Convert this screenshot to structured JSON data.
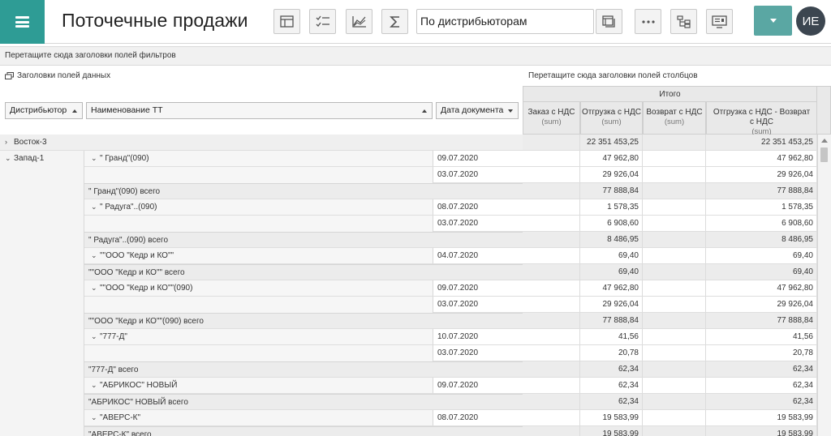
{
  "app": {
    "title": "Поточечные продажи",
    "view_select": "По дистрибьюторам",
    "avatar_initials": "ИЕ",
    "accent_color": "#2e9c95"
  },
  "toolbar": {
    "icons": [
      "table-layout-icon",
      "checklist-icon",
      "chart-icon",
      "sigma-icon",
      "view-list-icon",
      "more-icon",
      "hierarchy-icon",
      "screen-icon"
    ]
  },
  "pivot": {
    "filter_drop_hint": "Перетащите сюда заголовки полей фильтров",
    "data_headers_label": "Заголовки полей данных",
    "column_drop_hint": "Перетащите сюда заголовки полей столбцов",
    "row_fields": [
      "Дистрибьютор",
      "Наименование ТТ",
      "Дата документа"
    ],
    "total_header": "Итого",
    "columns": [
      {
        "label": "Заказ с НДС",
        "sub": "(sum)"
      },
      {
        "label": "Отгрузка с НДС",
        "sub": "(sum)"
      },
      {
        "label": "Возврат с НДС",
        "sub": "(sum)"
      },
      {
        "label": "Отгрузка с НДС - Возврат с НДС",
        "sub": "(sum)"
      }
    ]
  },
  "rows": [
    {
      "level": 0,
      "dist": "Восток-3",
      "dist_chev": ">",
      "shipment": "22 351 453,25",
      "net": "22 351 453,25"
    },
    {
      "level": 1,
      "dist": "Запад-1",
      "dist_chev": "v",
      "tt": "\" Гранд\"(090)",
      "tt_chev": "v",
      "date": "09.07.2020",
      "shipment": "47 962,80",
      "net": "47 962,80"
    },
    {
      "level": 2,
      "date": "03.07.2020",
      "shipment": "29 926,04",
      "net": "29 926,04"
    },
    {
      "level": 3,
      "tt_total": "\" Гранд\"(090) всего",
      "shipment": "77 888,84",
      "net": "77 888,84"
    },
    {
      "level": 1,
      "tt": "\" Радуга\"..(090)",
      "tt_chev": "v",
      "date": "08.07.2020",
      "shipment": "1 578,35",
      "net": "1 578,35"
    },
    {
      "level": 2,
      "date": "03.07.2020",
      "shipment": "6 908,60",
      "net": "6 908,60"
    },
    {
      "level": 3,
      "tt_total": "\" Радуга\"..(090) всего",
      "shipment": "8 486,95",
      "net": "8 486,95"
    },
    {
      "level": 1,
      "tt": "\"\"ООО \"Кедр и КО\"\"",
      "tt_chev": "v",
      "date": "04.07.2020",
      "shipment": "69,40",
      "net": "69,40"
    },
    {
      "level": 3,
      "tt_total": "\"\"ООО \"Кедр и КО\"\" всего",
      "shipment": "69,40",
      "net": "69,40"
    },
    {
      "level": 1,
      "tt": "\"\"ООО \"Кедр и КО\"\"(090)",
      "tt_chev": "v",
      "date": "09.07.2020",
      "shipment": "47 962,80",
      "net": "47 962,80"
    },
    {
      "level": 2,
      "date": "03.07.2020",
      "shipment": "29 926,04",
      "net": "29 926,04"
    },
    {
      "level": 3,
      "tt_total": "\"\"ООО \"Кедр и КО\"\"(090) всего",
      "shipment": "77 888,84",
      "net": "77 888,84"
    },
    {
      "level": 1,
      "tt": "\"777-Д\"",
      "tt_chev": "v",
      "date": "10.07.2020",
      "shipment": "41,56",
      "net": "41,56"
    },
    {
      "level": 2,
      "date": "03.07.2020",
      "shipment": "20,78",
      "net": "20,78"
    },
    {
      "level": 3,
      "tt_total": "\"777-Д\" всего",
      "shipment": "62,34",
      "net": "62,34"
    },
    {
      "level": 1,
      "tt": "\"АБРИКОС\" НОВЫЙ",
      "tt_chev": "v",
      "date": "09.07.2020",
      "shipment": "62,34",
      "net": "62,34"
    },
    {
      "level": 3,
      "tt_total": "\"АБРИКОС\" НОВЫЙ всего",
      "shipment": "62,34",
      "net": "62,34"
    },
    {
      "level": 1,
      "tt": "\"АВЕРС-К\"",
      "tt_chev": "v",
      "date": "08.07.2020",
      "shipment": "19 583,99",
      "net": "19 583,99"
    },
    {
      "level": 3,
      "tt_total": "\"АВЕРС-К\" всего",
      "shipment": "19 583,99",
      "net": "19 583,99"
    }
  ]
}
